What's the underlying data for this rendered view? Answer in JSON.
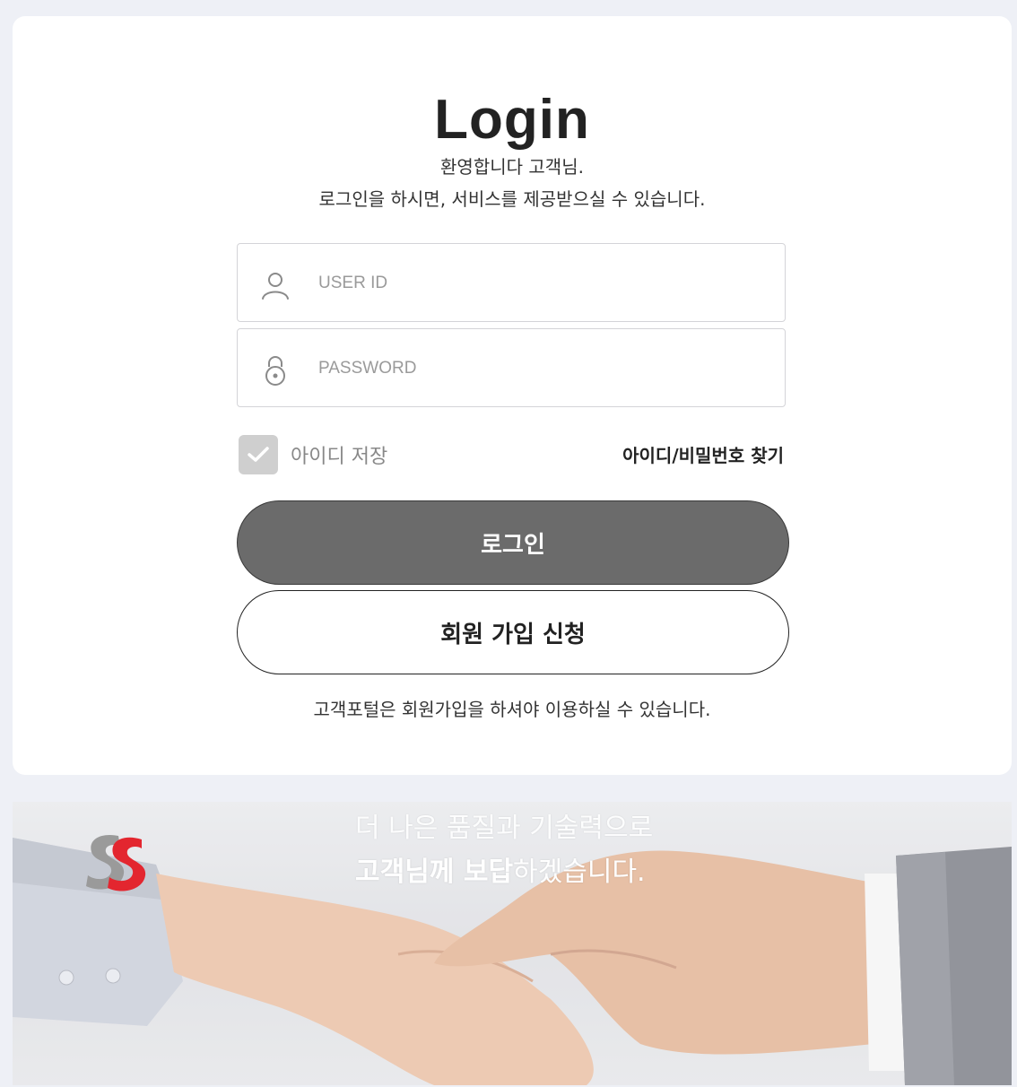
{
  "page": {
    "title": "Login",
    "welcome_line1": "환영합니다 고객님.",
    "welcome_line2": "로그인을 하시면, 서비스를 제공받으실 수 있습니다."
  },
  "form": {
    "userid_placeholder": "USER ID",
    "userid_value": "",
    "password_placeholder": "PASSWORD",
    "password_value": "",
    "remember_label": "아이디 저장",
    "remember_checked": true,
    "find_link": "아이디/비밀번호 찾기",
    "login_button": "로그인",
    "join_button": "회원 가입 신청",
    "notice": "고객포털은 회원가입을 하셔야 이용하실 수 있습니다."
  },
  "banner": {
    "line1": "더 나은 품질과 기술력으로",
    "line2_bold": "고객님께 보답",
    "line2_rest": "하겠습니다.",
    "logo_letters": "SS"
  },
  "icons": {
    "user": "user-icon",
    "lock": "lock-icon",
    "check": "check-icon"
  },
  "colors": {
    "background": "#eef0f6",
    "login_button": "#6b6b6b",
    "logo_red": "#e3262f",
    "logo_gray": "#9a9a9a"
  }
}
